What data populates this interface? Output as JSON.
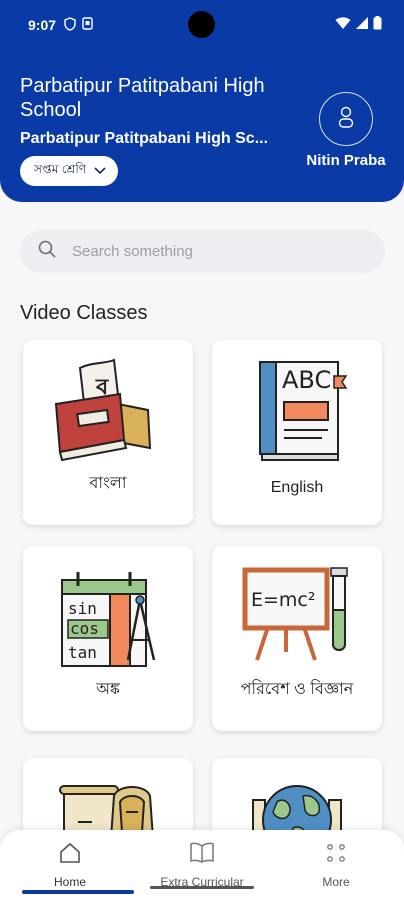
{
  "status": {
    "time": "9:07"
  },
  "header": {
    "school_name": "Parbatipur Patitpabani High School",
    "school_subtitle": "Parbatipur Patitpabani High Sc...",
    "class_selector": "সপ্তম শ্রেণি",
    "user_name": "Nitin Praba"
  },
  "search": {
    "placeholder": "Search something"
  },
  "section": {
    "title": "Video Classes"
  },
  "subjects": [
    {
      "label": "বাংলা",
      "icon": "bengali-book-icon"
    },
    {
      "label": "English",
      "icon": "abc-book-icon"
    },
    {
      "label": "অঙ্ক",
      "icon": "math-trig-icon"
    },
    {
      "label": "পরিবেশ ও বিজ্ঞান",
      "icon": "science-board-icon"
    },
    {
      "label": "",
      "icon": "history-pharaoh-icon"
    },
    {
      "label": "",
      "icon": "globe-icon"
    }
  ],
  "bottom_nav": {
    "home": "Home",
    "extra": "Extra Curricular",
    "more": "More"
  },
  "colors": {
    "primary": "#0a3aa6",
    "background": "#f7f7f9"
  }
}
